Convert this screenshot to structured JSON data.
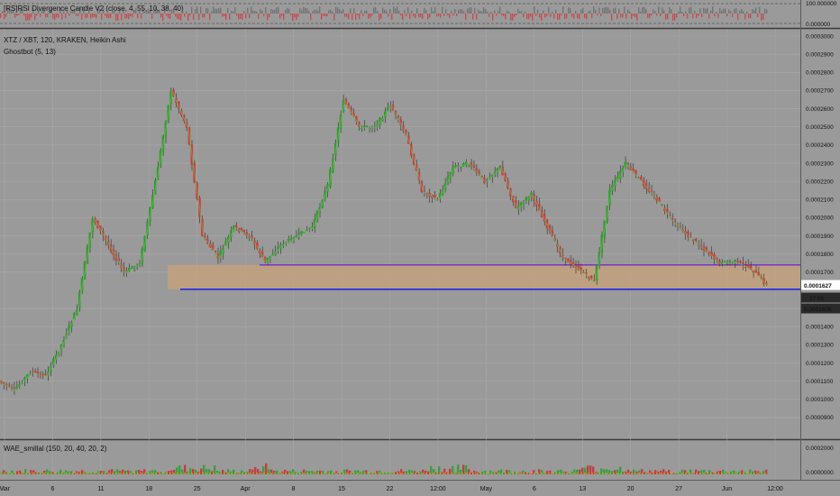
{
  "theme": {
    "background": "#9a9a9a",
    "grid": "#a9a9a9",
    "up_color": "#2e9e2e",
    "down_color": "#d13a3a",
    "wick_color": "#2b2b2b",
    "zone_color": "#c8a27a",
    "line_blue": "#1a1aee",
    "line_purple": "#7a34c8",
    "dark_tag": "#2a2a2a",
    "light_tag": "#ffffff"
  },
  "top_pane": {
    "legend": "[RS]RSI Divergence Candle V2 (close, 4, 55, 10, 38, 40)",
    "axis_labels": [
      "100.000000",
      "0.000000"
    ]
  },
  "main_pane": {
    "symbol_line": "XTZ / XBT, 120, KRAKEN, Heikin Ashi",
    "indicator_line": "Ghostbot (5, 13)",
    "price_labels": [
      "0.0003000",
      "0.0002900",
      "0.0002800",
      "0.0002700",
      "0.0002600",
      "0.0002500",
      "0.0002400",
      "0.0002300",
      "0.0002200",
      "0.0002100",
      "0.0002000",
      "0.0001900",
      "0.0001800",
      "0.0001700",
      "0.0001500",
      "0.0001400",
      "0.0001300",
      "0.0001200",
      "0.0001100",
      "0.0001000",
      "0.0000900"
    ],
    "last_price": "0.0001627",
    "countdown": "27:56",
    "zone_low_price": "0.0001606"
  },
  "bottom_pane": {
    "legend": "WAE_smillal (150, 20, 40, 20, 2)",
    "axis_labels": [
      "0.0000000",
      "0.0002000"
    ]
  },
  "date_labels": [
    "Mar",
    "6",
    "11",
    "18",
    "25",
    "Apr",
    "8",
    "15",
    "22",
    "12:00",
    "May",
    "6",
    "13",
    "20",
    "27",
    "Jun",
    "12:00"
  ],
  "chart_data": {
    "type": "candlestick",
    "title": "XTZ / XBT, 120, KRAKEN, Heikin Ashi",
    "ylim": [
      8.5e-05,
      0.0003
    ],
    "support_zone": [
      0.0001606,
      0.000174
    ],
    "purple_line": 0.000174,
    "blue_line": 0.0001606,
    "price_path": [
      {
        "x": "Mar",
        "y": 0.00011
      },
      {
        "x": "6",
        "y": 0.000105
      },
      {
        "x": "11",
        "y": 0.000115
      },
      {
        "x": "13",
        "y": 0.000113
      },
      {
        "x": "16",
        "y": 0.00013
      },
      {
        "x": "18",
        "y": 0.00015
      },
      {
        "x": "19",
        "y": 0.0002
      },
      {
        "x": "20",
        "y": 0.000185
      },
      {
        "x": "22",
        "y": 0.00017
      },
      {
        "x": "24",
        "y": 0.000175
      },
      {
        "x": "26",
        "y": 0.00022
      },
      {
        "x": "28",
        "y": 0.00027
      },
      {
        "x": "29",
        "y": 0.00025
      },
      {
        "x": "31",
        "y": 0.00019
      },
      {
        "x": "Apr",
        "y": 0.000178
      },
      {
        "x": "3",
        "y": 0.000195
      },
      {
        "x": "5",
        "y": 0.00019
      },
      {
        "x": "7",
        "y": 0.000176
      },
      {
        "x": "8",
        "y": 0.000185
      },
      {
        "x": "11",
        "y": 0.00019
      },
      {
        "x": "13",
        "y": 0.000195
      },
      {
        "x": "15",
        "y": 0.000218
      },
      {
        "x": "17",
        "y": 0.000265
      },
      {
        "x": "19",
        "y": 0.00025
      },
      {
        "x": "21",
        "y": 0.00025
      },
      {
        "x": "22",
        "y": 0.000262
      },
      {
        "x": "23",
        "y": 0.000245
      },
      {
        "x": "25",
        "y": 0.000215
      },
      {
        "x": "26",
        "y": 0.00021
      },
      {
        "x": "28",
        "y": 0.000228
      },
      {
        "x": "30",
        "y": 0.00023
      },
      {
        "x": "May",
        "y": 0.00022
      },
      {
        "x": "3",
        "y": 0.000228
      },
      {
        "x": "5",
        "y": 0.000205
      },
      {
        "x": "7",
        "y": 0.000213
      },
      {
        "x": "9",
        "y": 0.000195
      },
      {
        "x": "11",
        "y": 0.000178
      },
      {
        "x": "13",
        "y": 0.000172
      },
      {
        "x": "14",
        "y": 0.000165
      },
      {
        "x": "15",
        "y": 0.000215
      },
      {
        "x": "16",
        "y": 0.00023
      },
      {
        "x": "18",
        "y": 0.00022
      },
      {
        "x": "20",
        "y": 0.00021
      },
      {
        "x": "22",
        "y": 0.000198
      },
      {
        "x": "24",
        "y": 0.00019
      },
      {
        "x": "26",
        "y": 0.000183
      },
      {
        "x": "29",
        "y": 0.000175
      },
      {
        "x": "31",
        "y": 0.000176
      },
      {
        "x": "Jun",
        "y": 0.000172
      },
      {
        "x": "2",
        "y": 0.000163
      }
    ],
    "rsi_pane_ylim": [
      0,
      100
    ],
    "wae_pane_ylim": [
      0,
      0.0002
    ]
  }
}
